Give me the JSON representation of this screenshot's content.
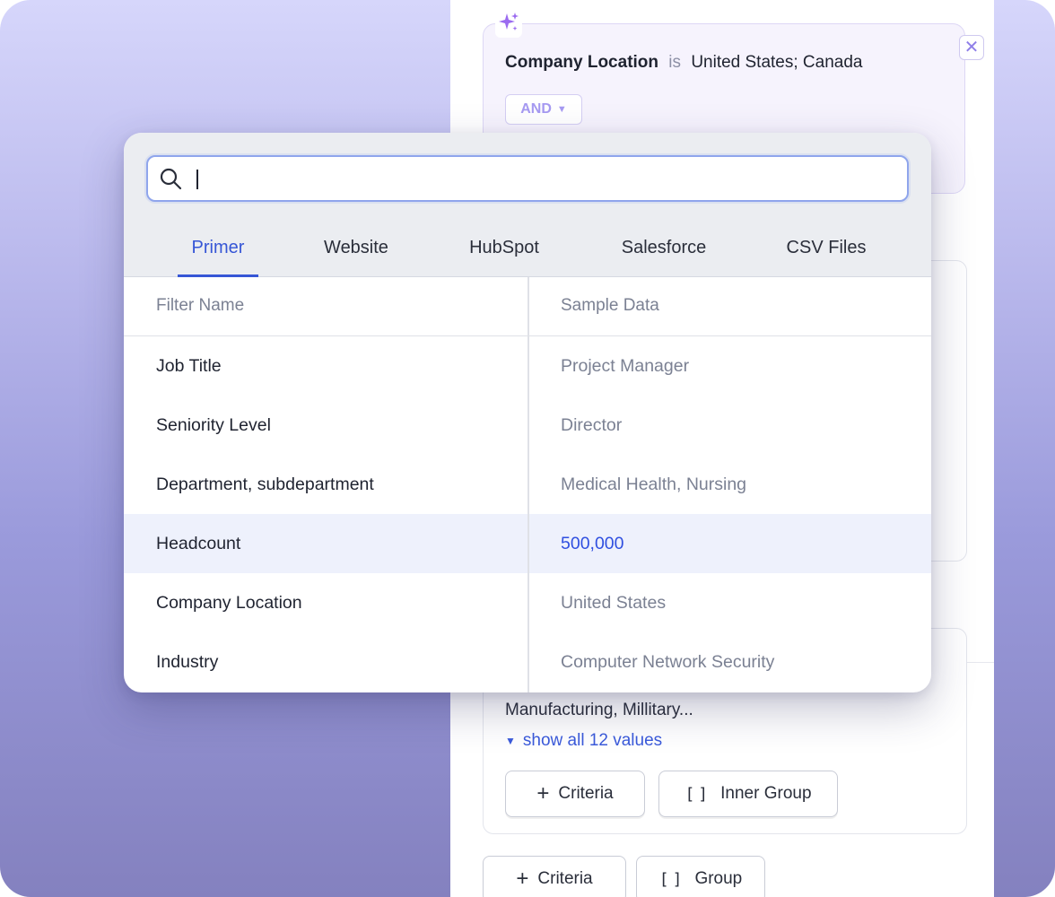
{
  "condition": {
    "field": "Company Location",
    "operator": "is",
    "value": "United States; Canada",
    "logic": "AND"
  },
  "lower_group": {
    "values_text": "Manufacturing, Millitary...",
    "show_all_label": "show all 12 values",
    "criteria_label": "Criteria",
    "inner_group_label": "Inner Group"
  },
  "footer": {
    "criteria_label": "Criteria",
    "group_label": "Group"
  },
  "search": {
    "value": "",
    "placeholder": ""
  },
  "tabs": [
    {
      "label": "Primer",
      "active": true
    },
    {
      "label": "Website"
    },
    {
      "label": "HubSpot"
    },
    {
      "label": "Salesforce"
    },
    {
      "label": "CSV Files"
    }
  ],
  "table": {
    "columns": [
      "Filter Name",
      "Sample Data"
    ],
    "rows": [
      {
        "name": "Job Title",
        "sample": "Project Manager"
      },
      {
        "name": "Seniority Level",
        "sample": "Director"
      },
      {
        "name": "Department, subdepartment",
        "sample": "Medical Health, Nursing"
      },
      {
        "name": "Headcount",
        "sample": "500,000",
        "highlighted": true
      },
      {
        "name": "Company Location",
        "sample": "United States"
      },
      {
        "name": "Industry",
        "sample": "Computer Network Security"
      }
    ]
  },
  "colors": {
    "accent": "#3656d6",
    "sparkle": "#9b6bf0",
    "highlight_row": "#eef1fc"
  }
}
